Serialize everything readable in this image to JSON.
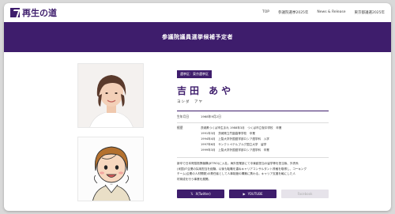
{
  "site": {
    "logo_text": "再生の道",
    "brand_color": "#3e1d6c"
  },
  "nav": [
    "TOP",
    "参議院選挙2025年",
    "News & Release",
    "東京都議選2025年"
  ],
  "hero": {
    "title": "参議院議員選挙候補予定者"
  },
  "candidate": {
    "district": "選挙区：東京選挙区",
    "name": "吉田 あや",
    "kana": "ヨシダ　アヤ",
    "dob_label": "生年月日",
    "dob": "1968年9月2日",
    "career_label": "経歴",
    "career": [
      "茨城県つくば市生まれ 1988年3月　つくば市立桜中学校　卒業",
      "1991年3月　茨城県立竹園高等学校　卒業",
      "1994年4月　上智大学外国語学部ロシア語学科　入学",
      "1997年6月　サンクトペテルブルグ国立大学　留学",
      "1999年3月　上智大学外国語学部ロシア語学科　卒業"
    ],
    "bio": "新卒で日本貿易振興機構(JETRO)に入社。海外営業部にて中東欧担当の留学等を担当後、外資系(米国)IT企業の採用担当を経験。以後も転職を重ねキャリアコンサルタント資格を取得し、コーキングチーム(企業の人材開発)の責任者として人事制度の構築に携わる。キャリア支援を軸にした人材育成を行う事業を展開。",
    "bio_lines": [
      "新卒で日本貿易振興機構(JETRO)に入社。海外営業部にて中東欧担当の留学等を担当後、外資系",
      "(米国)IT企業の採用担当を経験。以後も転職を重ねキャリアコンサルタント資格を取得し、コーキング",
      "チーム(企業の人材開発)の責任者として人事制度の構築に携わる。キャリア支援を軸にした人",
      "材育成を行う事業を展開。"
    ]
  },
  "sns": {
    "x": "X(Twitter)",
    "youtube": "YOUTUBE",
    "facebook": "Facebook"
  }
}
